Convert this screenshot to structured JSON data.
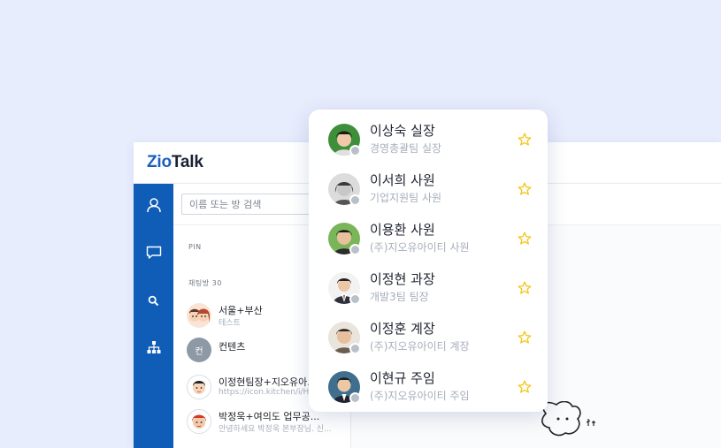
{
  "app": {
    "logo_part1": "Zio",
    "logo_part2": "Talk"
  },
  "rail": {
    "items": [
      {
        "icon": "person-icon"
      },
      {
        "icon": "chat-icon"
      },
      {
        "icon": "search-icon"
      },
      {
        "icon": "org-chart-icon"
      }
    ]
  },
  "panel": {
    "search_placeholder": "이름 또는 방 검색",
    "pin_label": "PIN",
    "rooms_label": "채팅방 30",
    "rooms": [
      {
        "name": "서울+부산",
        "preview": "테스트",
        "avatar": "cartoon-couple-avatar"
      },
      {
        "name": "컨텐츠",
        "preview": "",
        "avatar_letter": "컨"
      },
      {
        "name": "이정현팀장+지오유아...",
        "preview": "https://icon.kitchen/i/H4",
        "avatar": "cartoon-man-avatar"
      },
      {
        "name": "박정욱+여의도 업무공...",
        "preview": "안녕하세요 박정욱 본부장님. 신...",
        "avatar": "cartoon-group-avatar"
      }
    ]
  },
  "popup": {
    "contacts": [
      {
        "name": "이상숙 실장",
        "title": "경영총괄팀 실장",
        "photo": "photo-woman-green-bg"
      },
      {
        "name": "이서희 사원",
        "title": "기업지원팀 사원",
        "photo": "photo-woman-bw"
      },
      {
        "name": "이용환 사원",
        "title": "(주)지오유아이티 사원",
        "photo": "photo-man-green-bg"
      },
      {
        "name": "이정현 과장",
        "title": "개발3팀 팀장",
        "photo": "photo-man-suit"
      },
      {
        "name": "이정훈 계장",
        "title": "(주)지오유아이티 계장",
        "photo": "photo-man-casual"
      },
      {
        "name": "이현규 주임",
        "title": "(주)지오유아이티 주임",
        "photo": "photo-man-dark-suit"
      }
    ],
    "star_color": "#f5c518"
  },
  "colors": {
    "background": "#e8edfd",
    "rail": "#0f5db7",
    "brand": "#1b5fc1"
  }
}
